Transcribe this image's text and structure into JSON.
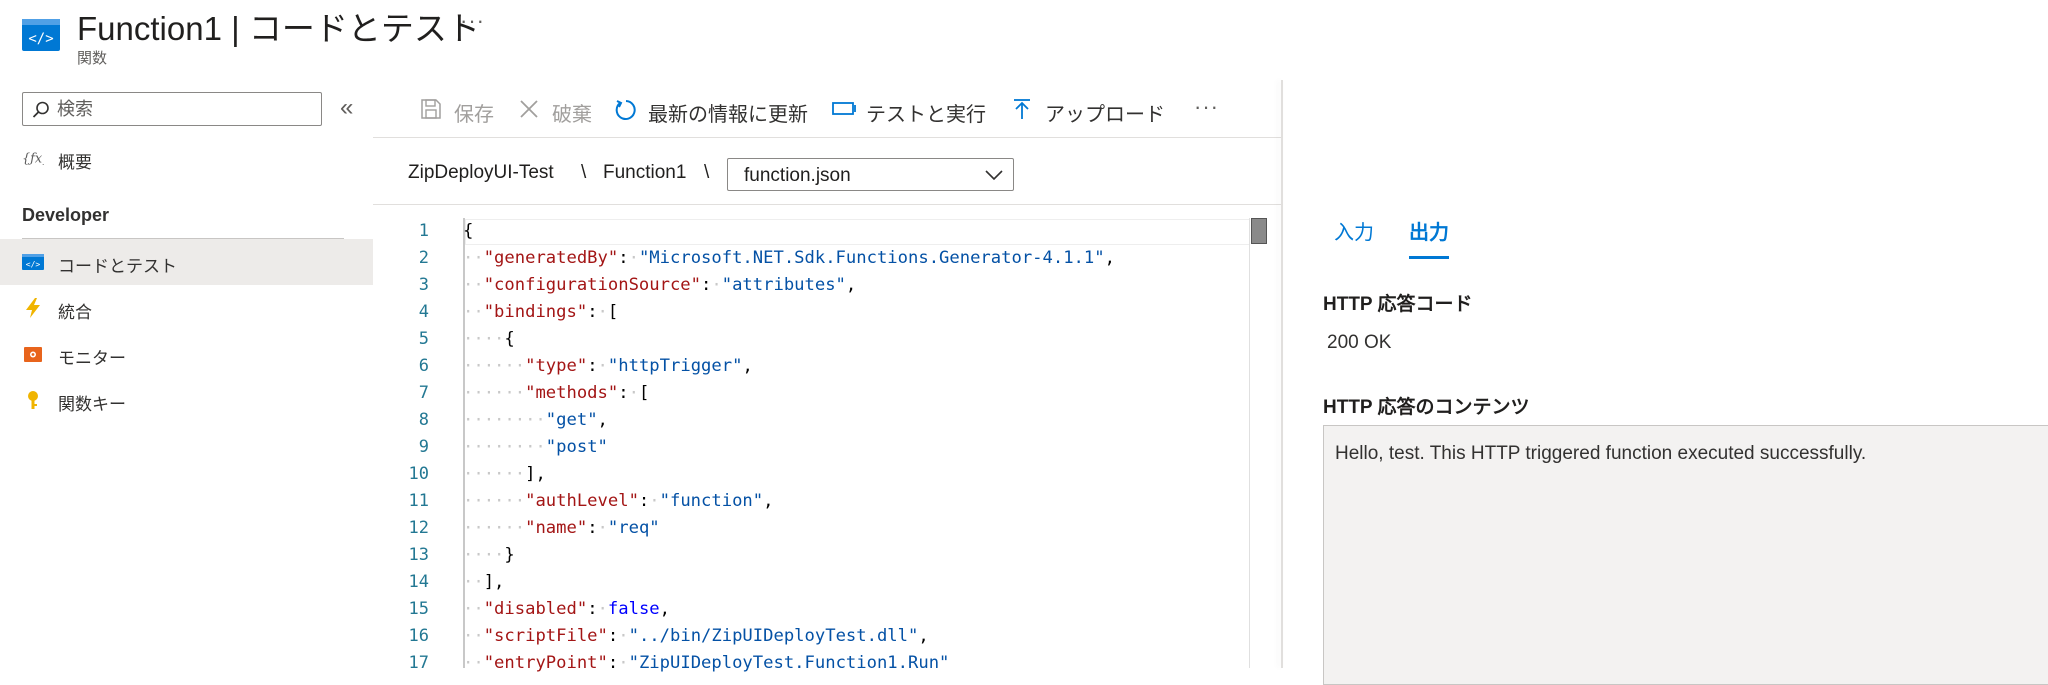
{
  "header": {
    "title": "Function1 | コードとテスト",
    "subtitle": "関数",
    "more": "···"
  },
  "sidebar": {
    "search_placeholder": "検索",
    "collapse": "«",
    "overview": "概要",
    "section": "Developer",
    "items": [
      {
        "label": "コードとテスト",
        "icon": "code-test-icon",
        "active": true
      },
      {
        "label": "統合",
        "icon": "lightning-icon"
      },
      {
        "label": "モニター",
        "icon": "monitor-icon"
      },
      {
        "label": "関数キー",
        "icon": "key-icon"
      }
    ]
  },
  "toolbar": {
    "save": "保存",
    "discard": "破棄",
    "refresh": "最新の情報に更新",
    "test_run": "テストと実行",
    "upload": "アップロード",
    "more": "···"
  },
  "breadcrumb": {
    "app": "ZipDeployUI-Test",
    "function": "Function1",
    "sep": "\\",
    "file": "function.json"
  },
  "editor": {
    "line_numbers": [
      "1",
      "2",
      "3",
      "4",
      "5",
      "6",
      "7",
      "8",
      "9",
      "10",
      "11",
      "12",
      "13",
      "14",
      "15",
      "16",
      "17"
    ]
  },
  "result": {
    "tab_input": "入力",
    "tab_output": "出力",
    "code_label": "HTTP 応答コード",
    "code_value": "200 OK",
    "content_label": "HTTP 応答のコンテンツ",
    "content_value": "Hello, test. This HTTP triggered function executed successfully."
  },
  "colors": {
    "accent": "#0078d4",
    "json_key": "#a31515",
    "json_string": "#0451a5",
    "json_bool": "#0000ff"
  }
}
